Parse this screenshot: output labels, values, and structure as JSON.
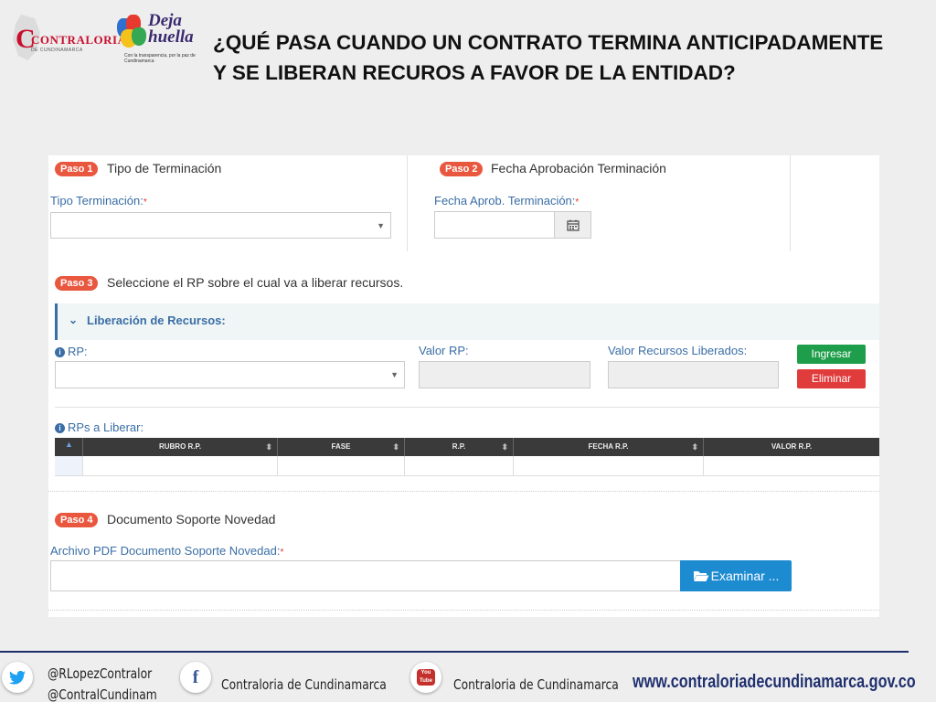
{
  "header": {
    "logo_contraloria_text": "CONTRALORIA",
    "logo_contraloria_sub": "DE CUNDINAMARCA",
    "logo_huella_text": "Deja huella",
    "logo_huella_tag": "Con la transparencia, por la paz de Cundinamarca",
    "title": "¿QUÉ PASA CUANDO UN CONTRATO TERMINA ANTICIPADAMENTE Y SE LIBERAN RECUROS A FAVOR DE LA ENTIDAD?"
  },
  "form": {
    "step1": {
      "badge": "Paso 1",
      "title": "Tipo de Terminación",
      "field_label": "Tipo Terminación:"
    },
    "step2": {
      "badge": "Paso 2",
      "title": "Fecha Aprobación Terminación",
      "field_label": "Fecha Aprob. Terminación:"
    },
    "step3": {
      "badge": "Paso 3",
      "title": "Seleccione el RP sobre el cual va a liberar recursos.",
      "accordion_title": "Liberación de Recursos:",
      "rp_label": "RP:",
      "valor_rp_label": "Valor RP:",
      "valor_liberados_label": "Valor Recursos Liberados:",
      "btn_ingresar": "Ingresar",
      "btn_eliminar": "Eliminar",
      "grid_title": "RPs a Liberar:",
      "grid_columns": [
        "RUBRO R.P.",
        "FASE",
        "R.P.",
        "FECHA R.P.",
        "VALOR R.P."
      ]
    },
    "step4": {
      "badge": "Paso 4",
      "title": "Documento Soporte Novedad",
      "field_label": "Archivo PDF Documento Soporte Novedad:",
      "btn_examinar": "Examinar ..."
    },
    "required_mark": "*"
  },
  "footer": {
    "twitter_1": "@RLopezContralor",
    "twitter_2": "@ContralCundinam",
    "facebook": "Contraloria de Cundinamarca",
    "youtube": "Contraloria de Cundinamarca",
    "youtube_icon_text": "You Tube",
    "url": "www.contraloriadecundinamarca.gov.co",
    "accent_color": "#1f2f6e"
  }
}
